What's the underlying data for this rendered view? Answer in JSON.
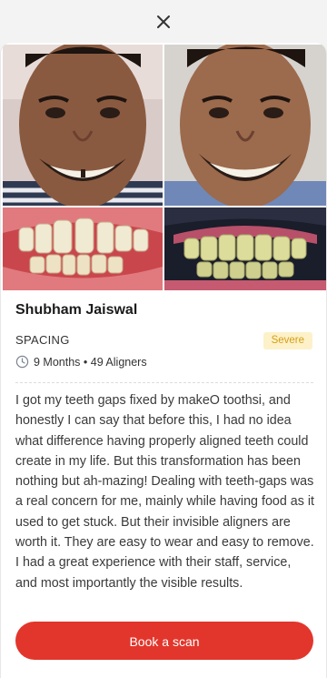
{
  "dialog": {
    "close_icon": "close-icon"
  },
  "testimonial": {
    "name": "Shubham Jaiswal",
    "category": "SPACING",
    "severity": "Severe",
    "duration": "9 Months",
    "aligners": "49 Aligners",
    "clock_icon": "clock-icon",
    "review": "I got my teeth gaps fixed by makeO toothsi, and honestly I can say that before this, I had no idea what difference having properly aligned teeth could create in my life. But this transformation has been nothing but ah-mazing! Dealing with teeth-gaps was a real concern for me, mainly while having food as it used to get stuck. But their invisible aligners are worth it. They are easy to wear and easy to remove. I had a great experience with their staff, service, and most importantly the visible results."
  },
  "photos": [
    {
      "label": "before-smile"
    },
    {
      "label": "after-smile"
    },
    {
      "label": "before-teeth-closeup"
    },
    {
      "label": "after-teeth-closeup"
    }
  ],
  "cta": {
    "label": "Book a scan"
  },
  "colors": {
    "accent": "#e2362c",
    "badge_bg": "#fdf1c9",
    "badge_text": "#d4a017"
  }
}
